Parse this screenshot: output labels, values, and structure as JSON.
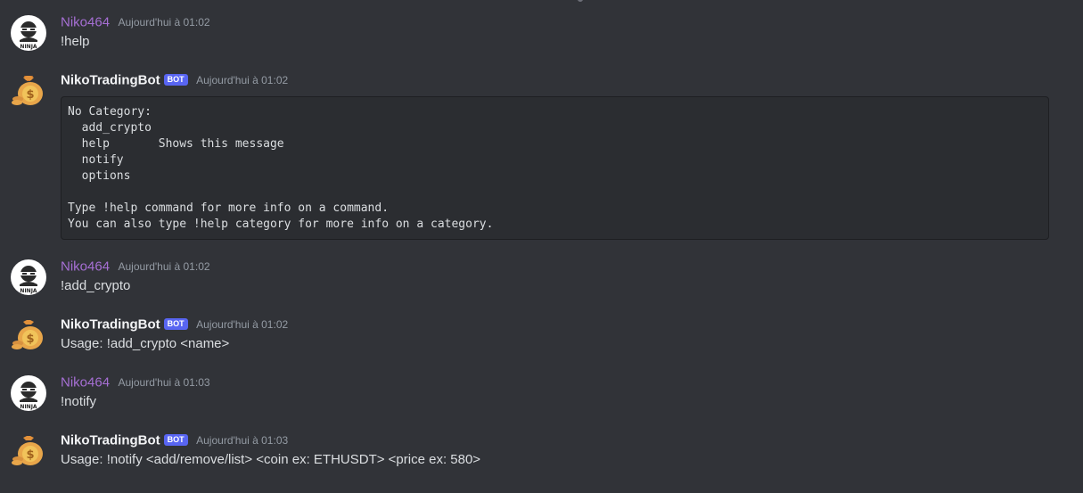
{
  "messages": [
    {
      "author": "Niko464",
      "time": "Aujourd'hui à 01:02",
      "text": "!help"
    },
    {
      "author": "NikoTradingBot",
      "badge": "BOT",
      "time": "Aujourd'hui à 01:02"
    },
    {
      "author": "Niko464",
      "time": "Aujourd'hui à 01:02",
      "text": "!add_crypto"
    },
    {
      "author": "NikoTradingBot",
      "badge": "BOT",
      "time": "Aujourd'hui à 01:02",
      "text": "Usage: !add_crypto <name>"
    },
    {
      "author": "Niko464",
      "time": "Aujourd'hui à 01:03",
      "text": "!notify"
    },
    {
      "author": "NikoTradingBot",
      "badge": "BOT",
      "time": "Aujourd'hui à 01:03",
      "text": "Usage: !notify <add/remove/list> <coin ex: ETHUSDT> <price ex: 580>"
    }
  ],
  "code_block": {
    "lines": [
      "No Category:",
      "  add_crypto",
      "  help       Shows this message",
      "  notify",
      "  options",
      "",
      "Type !help command for more info on a command.",
      "You can also type !help category for more info on a category."
    ]
  },
  "avatars": {
    "user_label": "NINJA",
    "bot_symbol": "$"
  },
  "colors": {
    "background": "#313338",
    "user_name": "#a66fd4",
    "bot_name": "#f2f3f5",
    "badge": "#5865f2",
    "timestamp": "#949ba4",
    "code_bg": "#2b2d31"
  }
}
